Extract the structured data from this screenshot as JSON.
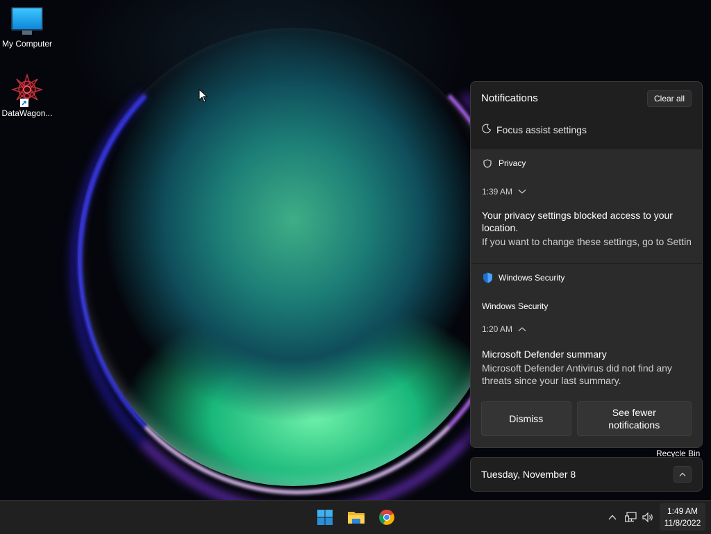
{
  "desktop": {
    "icons": [
      {
        "label": "My Computer",
        "icon": "monitor-icon"
      },
      {
        "label": "DataWagon...",
        "icon": "datawagon-logo-icon"
      }
    ],
    "recycle_bin_label": "Recycle Bin"
  },
  "notifications": {
    "title": "Notifications",
    "clear_all_label": "Clear all",
    "focus_assist_label": "Focus assist settings",
    "items": [
      {
        "app": "Privacy",
        "app_icon": "shield-outline-icon",
        "time": "1:39 AM",
        "expanded": false,
        "title": "Your privacy settings blocked access to your location.",
        "body": "If you want to change these settings, go to Settin"
      },
      {
        "app": "Windows Security",
        "app_icon": "windows-security-shield-icon",
        "sub_app": "Windows Security",
        "time": "1:20 AM",
        "expanded": true,
        "title": "Microsoft Defender summary",
        "body": "Microsoft Defender Antivirus did not find any threats since your last summary.",
        "actions": [
          "Dismiss",
          "See fewer notifications"
        ]
      }
    ]
  },
  "calendar": {
    "date_label": "Tuesday, November 8"
  },
  "taskbar": {
    "apps": [
      "start-icon",
      "file-explorer-icon",
      "chrome-icon"
    ],
    "tray_icons": [
      "chevron-up-icon",
      "network-icon",
      "volume-icon"
    ],
    "clock_time": "1:49 AM",
    "clock_date": "11/8/2022"
  },
  "colors": {
    "panel_bg": "#1f1f1f",
    "card_bg": "#2b2b2b",
    "taskbar_bg": "#202020",
    "accent_blue": "#0078d4"
  }
}
